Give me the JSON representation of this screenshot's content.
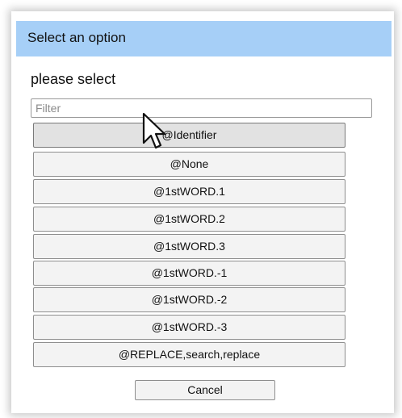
{
  "dialog": {
    "title": "Select an option",
    "prompt": "please select",
    "filter": {
      "placeholder": "Filter",
      "value": ""
    },
    "options": [
      "@Identifier",
      "@None",
      "@1stWORD.1",
      "@1stWORD.2",
      "@1stWORD.3",
      "@1stWORD.-1",
      "@1stWORD.-2",
      "@1stWORD.-3",
      "@REPLACE,search,replace"
    ],
    "hovered_option": "@Identifier",
    "cancel_label": "Cancel"
  },
  "colors": {
    "titlebar": "#a6cff7",
    "button_bg": "#f3f3f3",
    "button_hover_bg": "#e2e2e2"
  },
  "icons": {
    "pointer": "mouse-pointer-icon"
  }
}
